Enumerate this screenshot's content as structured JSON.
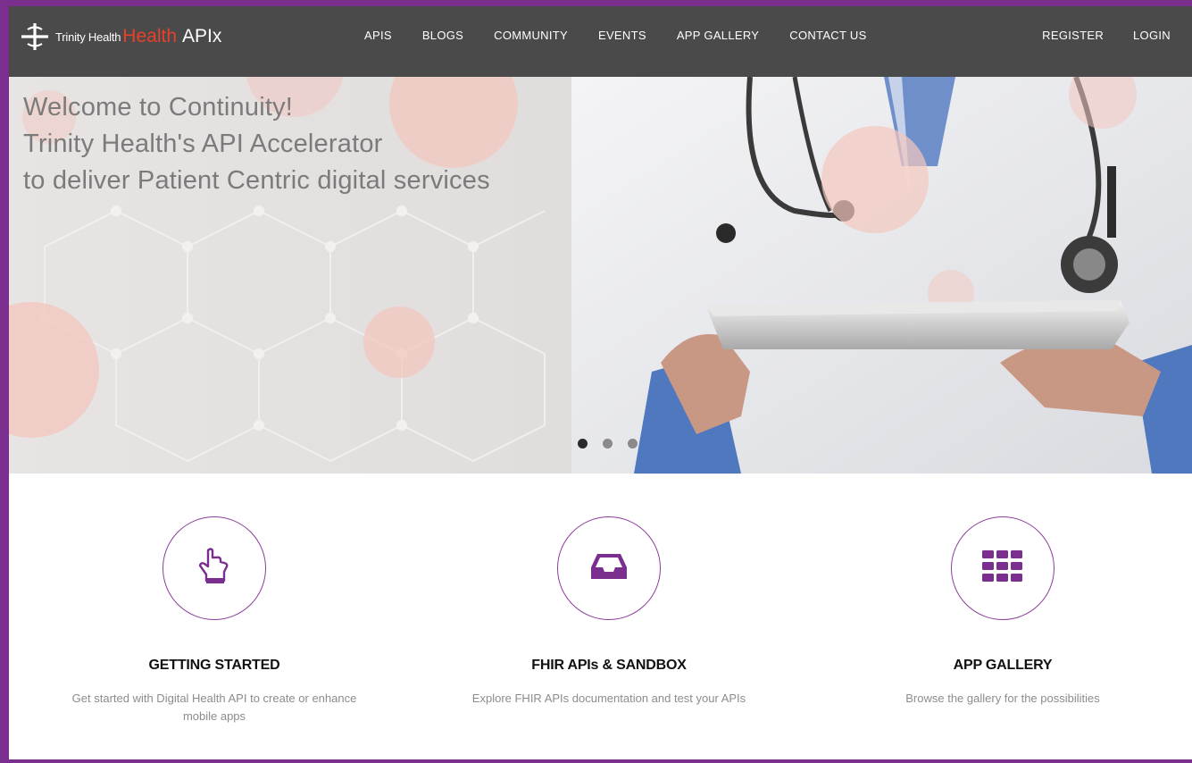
{
  "brand": {
    "org": "Trinity Health",
    "health": "Health",
    "apix": "APIx",
    "logo_icon": "trinity-cross-logo"
  },
  "nav": {
    "items": [
      "APIS",
      "BLOGS",
      "COMMUNITY",
      "EVENTS",
      "APP GALLERY",
      "CONTACT US"
    ],
    "register": "REGISTER",
    "login": "LOGIN"
  },
  "hero": {
    "line1": "Welcome to Continuity!",
    "line2": "Trinity Health's API Accelerator",
    "line3": "to deliver Patient Centric digital services",
    "carousel_slides": 3,
    "active_slide": 1
  },
  "features": [
    {
      "icon": "hand-pointer-icon",
      "title": "GETTING STARTED",
      "desc": "Get started with Digital Health API to create or enhance mobile apps"
    },
    {
      "icon": "inbox-icon",
      "title": "FHIR APIs & SANDBOX",
      "desc": "Explore FHIR APIs documentation and test your APIs"
    },
    {
      "icon": "grid-icon",
      "title": "APP GALLERY",
      "desc": "Browse the gallery for the possibilities"
    }
  ],
  "colors": {
    "accent": "#7a2e8e",
    "header_bg": "#4a4a4a",
    "brand_red": "#e8402a"
  }
}
